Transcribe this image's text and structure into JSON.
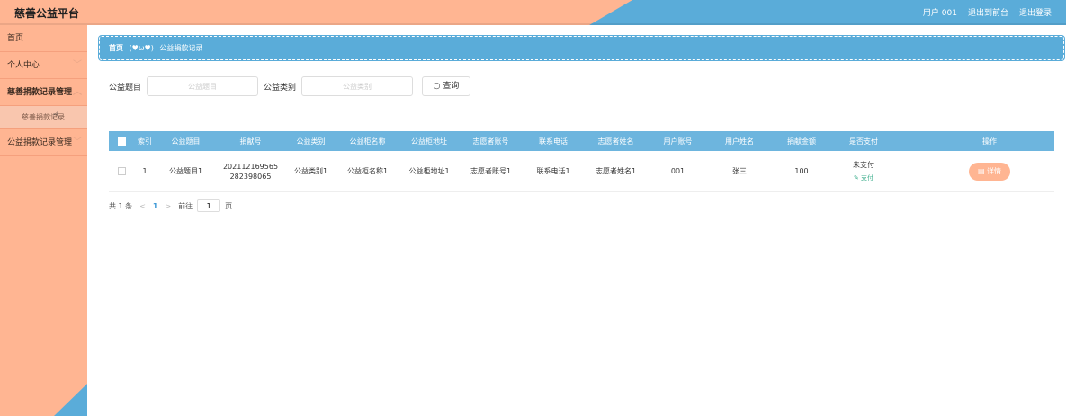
{
  "header": {
    "app_title": "慈善公益平台",
    "user_label": "用户 001",
    "back_to_front": "退出到前台",
    "logout": "退出登录"
  },
  "sidebar": {
    "items": [
      {
        "label": "首页"
      },
      {
        "label": "个人中心"
      },
      {
        "label": "慈善捐款记录管理"
      },
      {
        "label": "慈善捐款记录"
      },
      {
        "label": "公益捐款记录管理"
      }
    ],
    "chevron": "﹀"
  },
  "breadcrumb": {
    "home": "首页",
    "face": "(♥ω♥)",
    "current": "公益捐款记录"
  },
  "search": {
    "title_label": "公益题目",
    "title_placeholder": "公益题目",
    "category_label": "公益类别",
    "category_placeholder": "公益类别",
    "button_label": "查询"
  },
  "table": {
    "headers": [
      "索引",
      "公益题目",
      "捐献号",
      "公益类别",
      "公益柜名称",
      "公益柜地址",
      "志愿者账号",
      "联系电话",
      "志愿者姓名",
      "用户账号",
      "用户姓名",
      "捐献金额",
      "是否支付",
      "操作"
    ],
    "rows": [
      {
        "index": "1",
        "title": "公益题目1",
        "donation_no_line1": "202112169565",
        "donation_no_line2": "282398065",
        "category": "公益类别1",
        "cabinet_name": "公益柜名称1",
        "cabinet_address": "公益柜地址1",
        "volunteer_account": "志愿者账号1",
        "phone": "联系电话1",
        "volunteer_name": "志愿者姓名1",
        "user_account": "001",
        "user_name": "张三",
        "amount": "100",
        "pay_status": "未支付",
        "pay_link": "支付",
        "detail_button": "详情"
      }
    ]
  },
  "pager": {
    "total": "共 1 条",
    "prev": "<",
    "current_page": "1",
    "next": ">",
    "goto_label": "前往",
    "goto_value": "1",
    "page_unit": "页"
  },
  "colors": {
    "primary_peach": "#ffb592",
    "primary_blue": "#5aacd9",
    "header_blue": "#6db5de"
  }
}
